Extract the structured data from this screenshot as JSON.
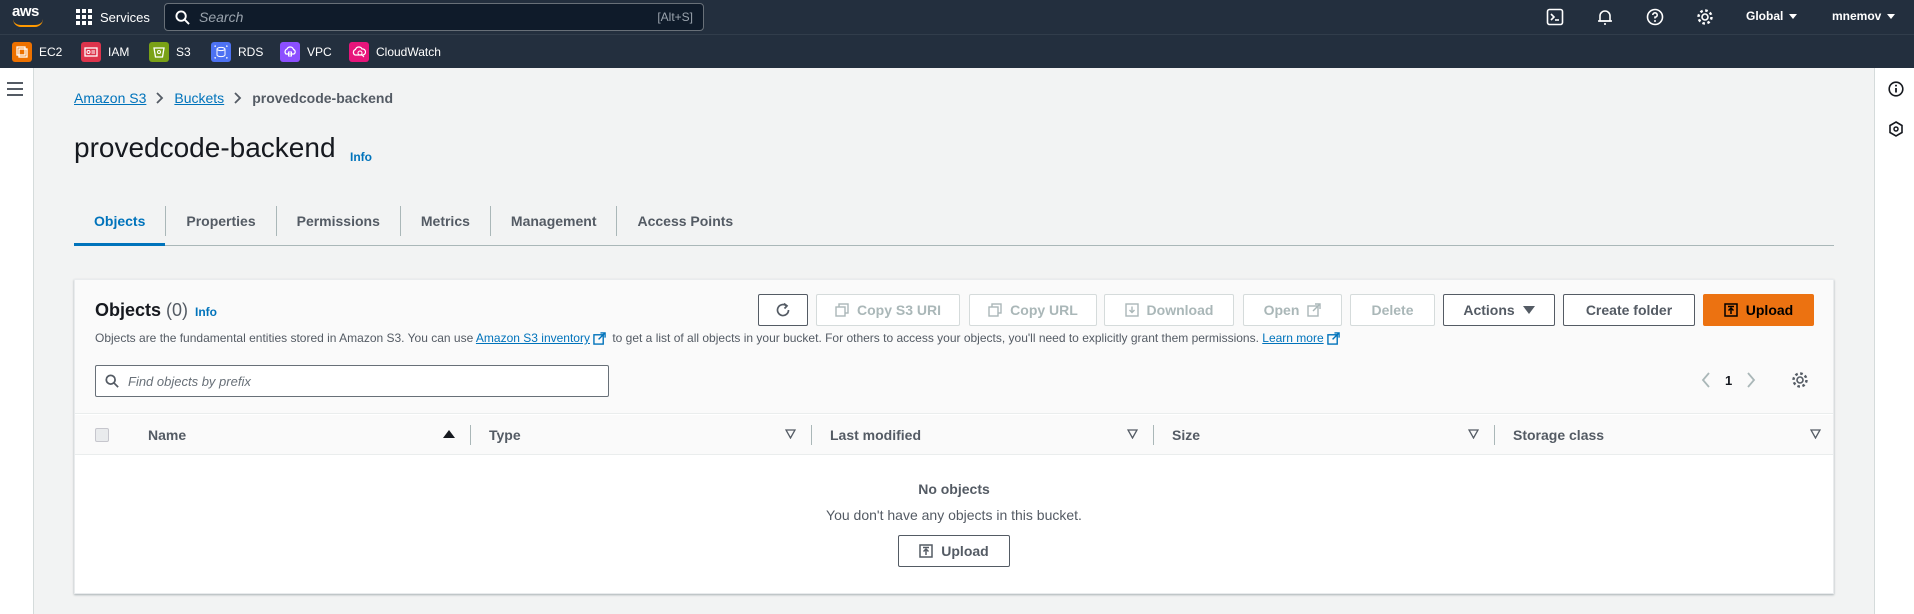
{
  "topnav": {
    "logo": "aws",
    "services_label": "Services",
    "search_placeholder": "Search",
    "search_shortcut": "[Alt+S]",
    "region": "Global",
    "user": "mnemov"
  },
  "favorites": [
    {
      "label": "EC2",
      "color": "#ed7100"
    },
    {
      "label": "IAM",
      "color": "#dd344c"
    },
    {
      "label": "S3",
      "color": "#7aa116"
    },
    {
      "label": "RDS",
      "color": "#4d72f3"
    },
    {
      "label": "VPC",
      "color": "#8c4fff"
    },
    {
      "label": "CloudWatch",
      "color": "#e7157b"
    }
  ],
  "breadcrumb": {
    "root": "Amazon S3",
    "buckets": "Buckets",
    "current": "provedcode-backend"
  },
  "page": {
    "title": "provedcode-backend",
    "info": "Info"
  },
  "tabs": [
    "Objects",
    "Properties",
    "Permissions",
    "Metrics",
    "Management",
    "Access Points"
  ],
  "objects": {
    "title": "Objects",
    "count": "(0)",
    "info": "Info",
    "desc_before": "Objects are the fundamental entities stored in Amazon S3. You can use",
    "desc_link": "Amazon S3 inventory",
    "desc_middle": "to get a list of all objects in your bucket. For others to access your objects, you'll need to explicitly grant them permissions.",
    "learn_more": "Learn more",
    "buttons": {
      "copy_uri": "Copy S3 URI",
      "copy_url": "Copy URL",
      "download": "Download",
      "open": "Open",
      "delete": "Delete",
      "actions": "Actions",
      "create_folder": "Create folder",
      "upload": "Upload"
    },
    "prefix_placeholder": "Find objects by prefix",
    "page_number": "1",
    "columns": [
      "Name",
      "Type",
      "Last modified",
      "Size",
      "Storage class"
    ],
    "empty_title": "No objects",
    "empty_desc": "You don't have any objects in this bucket.",
    "empty_upload": "Upload"
  },
  "colors": {
    "nav_bg": "#232f3e",
    "link": "#0073bb",
    "primary": "#ec7211"
  }
}
